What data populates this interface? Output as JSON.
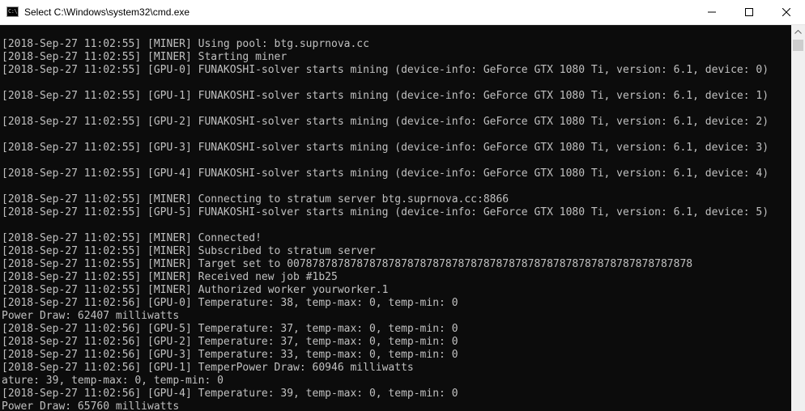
{
  "window": {
    "title": "Select C:\\Windows\\system32\\cmd.exe",
    "icon": "cmd-app-icon",
    "icon_glyph": "C:\\"
  },
  "controls": {
    "minimize_icon": "minimize-icon",
    "maximize_icon": "maximize-icon",
    "close_icon": "close-icon"
  },
  "console": {
    "lines": [
      "[2018-Sep-27 11:02:55] [MINER] Using pool: btg.suprnova.cc",
      "[2018-Sep-27 11:02:55] [MINER] Starting miner",
      "[2018-Sep-27 11:02:55] [GPU-0] FUNAKOSHI-solver starts mining (device-info: GeForce GTX 1080 Ti, version: 6.1, device: 0)",
      "",
      "[2018-Sep-27 11:02:55] [GPU-1] FUNAKOSHI-solver starts mining (device-info: GeForce GTX 1080 Ti, version: 6.1, device: 1)",
      "",
      "[2018-Sep-27 11:02:55] [GPU-2] FUNAKOSHI-solver starts mining (device-info: GeForce GTX 1080 Ti, version: 6.1, device: 2)",
      "",
      "[2018-Sep-27 11:02:55] [GPU-3] FUNAKOSHI-solver starts mining (device-info: GeForce GTX 1080 Ti, version: 6.1, device: 3)",
      "",
      "[2018-Sep-27 11:02:55] [GPU-4] FUNAKOSHI-solver starts mining (device-info: GeForce GTX 1080 Ti, version: 6.1, device: 4)",
      "",
      "[2018-Sep-27 11:02:55] [MINER] Connecting to stratum server btg.suprnova.cc:8866",
      "[2018-Sep-27 11:02:55] [GPU-5] FUNAKOSHI-solver starts mining (device-info: GeForce GTX 1080 Ti, version: 6.1, device: 5)",
      "",
      "[2018-Sep-27 11:02:55] [MINER] Connected!",
      "[2018-Sep-27 11:02:55] [MINER] Subscribed to stratum server",
      "[2018-Sep-27 11:02:55] [MINER] Target set to 0078787878787878787878787878787878787878787878787878787878787878",
      "[2018-Sep-27 11:02:55] [MINER] Received new job #1b25",
      "[2018-Sep-27 11:02:55] [MINER] Authorized worker yourworker.1",
      "[2018-Sep-27 11:02:56] [GPU-0] Temperature: 38, temp-max: 0, temp-min: 0",
      "Power Draw: 62407 milliwatts",
      "[2018-Sep-27 11:02:56] [GPU-5] Temperature: 37, temp-max: 0, temp-min: 0",
      "[2018-Sep-27 11:02:56] [GPU-2] Temperature: 37, temp-max: 0, temp-min: 0",
      "[2018-Sep-27 11:02:56] [GPU-3] Temperature: 33, temp-max: 0, temp-min: 0",
      "[2018-Sep-27 11:02:56] [GPU-1] TemperPower Draw: 60946 milliwatts",
      "ature: 39, temp-max: 0, temp-min: 0",
      "[2018-Sep-27 11:02:56] [GPU-4] Temperature: 39, temp-max: 0, temp-min: 0",
      "Power Draw: 65760 milliwatts"
    ]
  },
  "scrollbar": {
    "up_icon": "scroll-up-arrow-icon"
  },
  "colors": {
    "console_background": "#0c0c0c",
    "console_text": "#c0c0c0",
    "titlebar_background": "#ffffff",
    "scrollbar_track": "#f0f0f0",
    "scrollbar_thumb": "#cdcdcd"
  }
}
